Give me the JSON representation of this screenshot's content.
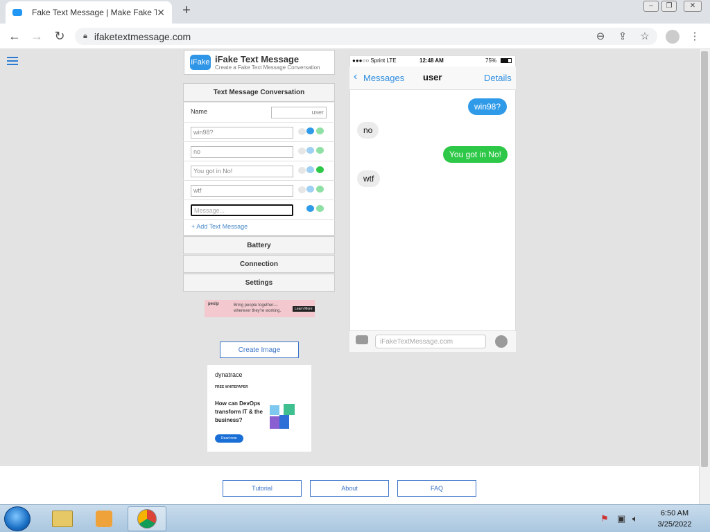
{
  "browser": {
    "tab_title": "Fake Text Message | Make Fake Te",
    "new_tab": "+",
    "url": "ifaketextmessage.com"
  },
  "site": {
    "logo_mark": "iFake",
    "name": "iFake Text Message",
    "tagline": "Create a Fake Text Message Conversation"
  },
  "form": {
    "section_title": "Text Message Conversation",
    "name_label": "Name",
    "name_value": "user",
    "messages": [
      {
        "text": "win98?",
        "sender": "me"
      },
      {
        "text": "no",
        "sender": "them"
      },
      {
        "text": "You got in No!",
        "sender": "me-sms"
      },
      {
        "text": "wtf",
        "sender": "them"
      }
    ],
    "new_message_placeholder": "Message...",
    "add_link": "+ Add Text Message",
    "sections": [
      "Battery",
      "Connection",
      "Settings"
    ],
    "create_button": "Create Image"
  },
  "ads": {
    "banner_brand": "pexip",
    "banner_text": "Bring people together— wherever they're working.",
    "banner_cta": "Learn More",
    "brand": "dynatrace",
    "label": "FREE WHITEPAPER",
    "headline": "How can DevOps transform IT & the business?",
    "cta": "Read now"
  },
  "phone": {
    "carrier": "●●●○○ Sprint  LTE",
    "time": "12:48 AM",
    "battery": "75%",
    "back_label": "Messages",
    "contact": "user",
    "details": "Details",
    "compose_placeholder": "iFakeTextMessage.com"
  },
  "footer": {
    "buttons": [
      "Tutorial",
      "About",
      "FAQ"
    ]
  },
  "taskbar": {
    "time": "6:50 AM",
    "date": "3/25/2022"
  },
  "colors": {
    "imessage_blue": "#2f9ae8",
    "sms_green": "#2dc847",
    "incoming_gray": "#ebebeb",
    "link_blue": "#3b73c7"
  }
}
